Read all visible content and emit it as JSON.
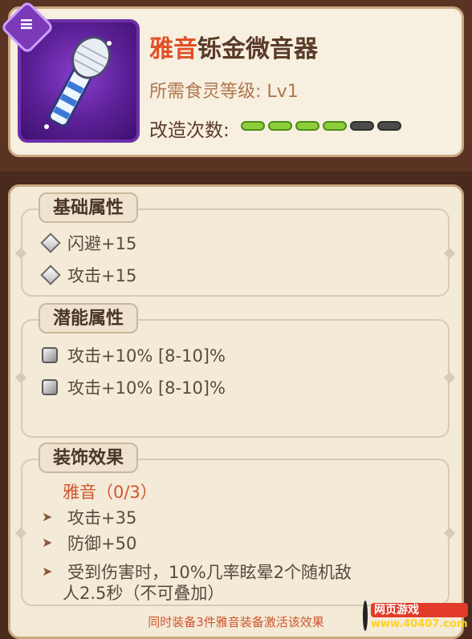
{
  "item": {
    "title_prefix": "雅音",
    "title_rest": "铄金微音器",
    "level_label": "所需食灵等级:",
    "level_value": "Lv1",
    "mod_label": "改造次数:",
    "mod_filled": 4,
    "mod_total": 6
  },
  "basic": {
    "tab": "基础属性",
    "stats": [
      "闪避+15",
      "攻击+15"
    ]
  },
  "potential": {
    "tab": "潜能属性",
    "stats": [
      "攻击+10% [8-10]%",
      "攻击+10% [8-10]%"
    ]
  },
  "decoration": {
    "tab": "装饰效果",
    "set_name": "雅音（0/3）",
    "effects": [
      "攻击+35",
      "防御+50",
      "受到伤害时，10%几率眩晕2个随机敌",
      "人2.5秒（不可叠加）"
    ],
    "footer": "同时装备3件雅音装备激活该效果"
  },
  "colors": {
    "accent_red": "#e0502a",
    "pip_on": "#8ccf3a",
    "pip_off": "#4b4b4b",
    "icon_bg": "#6e2fa8"
  },
  "watermark": {
    "line1": "网页游戏",
    "line2": "www.40407.com"
  }
}
